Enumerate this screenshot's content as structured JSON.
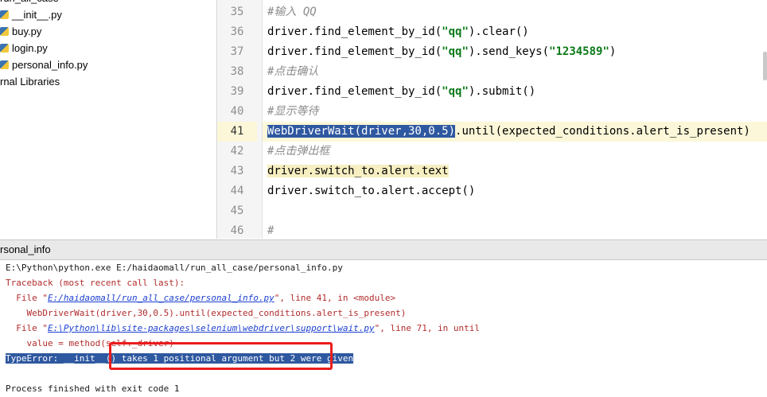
{
  "project_tree": {
    "items": [
      {
        "label": "run_all_case",
        "icon": "folder-icon"
      },
      {
        "label": "__init__.py",
        "icon": "python-file-icon"
      },
      {
        "label": "buy.py",
        "icon": "python-file-icon"
      },
      {
        "label": "login.py",
        "icon": "python-file-icon"
      },
      {
        "label": "personal_info.py",
        "icon": "python-file-icon"
      },
      {
        "label": "rnal Libraries",
        "icon": "library-icon"
      }
    ]
  },
  "editor": {
    "lines": [
      {
        "num": "35",
        "text": "#输入 QQ"
      },
      {
        "num": "36",
        "text": "driver.find_element_by_id(\"qq\").clear()"
      },
      {
        "num": "37",
        "text": "driver.find_element_by_id(\"qq\").send_keys(\"1234589\")"
      },
      {
        "num": "38",
        "text": "#点击确认"
      },
      {
        "num": "39",
        "text": "driver.find_element_by_id(\"qq\").submit()"
      },
      {
        "num": "40",
        "text": "#显示等待"
      },
      {
        "num": "41",
        "text_selected": "WebDriverWait(driver,30,0.5)",
        "text_rest": ".until(expected_conditions.alert_is_present)"
      },
      {
        "num": "42",
        "text": "#点击弹出框"
      },
      {
        "num": "43",
        "text": "driver.switch_to.alert.text"
      },
      {
        "num": "44",
        "text": "driver.switch_to.alert.accept()"
      },
      {
        "num": "45",
        "text": ""
      },
      {
        "num": "46",
        "text": "#"
      }
    ]
  },
  "run_panel": {
    "title": "rsonal_info",
    "console": {
      "cmd": "E:\\Python\\python.exe E:/haidaomall/run_all_case/personal_info.py",
      "traceback": "Traceback (most recent call last):",
      "file1_prefix": "  File \"",
      "file1_link": "E:/haidaomall/run_all_case/personal_info.py",
      "file1_suffix": "\", line 41, in <module>",
      "code1": "    WebDriverWait(driver,30,0.5).until(expected_conditions.alert_is_present)",
      "file2_prefix": "  File \"",
      "file2_link": "E:\\Python\\lib\\site-packages\\selenium\\webdriver\\support\\wait.py",
      "file2_suffix": "\", line 71, in until",
      "code2": "    value = method(self._driver)",
      "error": "TypeError: __init__() takes 1 positional argument but 2 were given",
      "exit": "Process finished with exit code 1"
    }
  },
  "colors": {
    "selection": "#2e58a0",
    "current_line": "#fcf7d8",
    "string": "#0a7a18",
    "error_text": "#b22c2c",
    "annotation": "#ea1d1d"
  }
}
